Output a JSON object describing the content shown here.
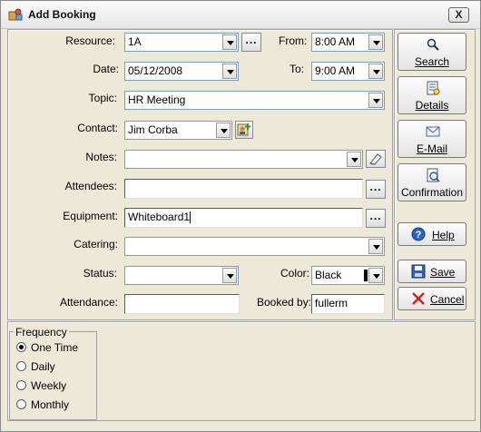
{
  "window": {
    "title": "Add Booking",
    "close_label": "X"
  },
  "form": {
    "resource_label": "Resource:",
    "resource_value": "1A",
    "from_label": "From:",
    "from_value": "8:00 AM",
    "date_label": "Date:",
    "date_value": "05/12/2008",
    "to_label": "To:",
    "to_value": "9:00 AM",
    "topic_label": "Topic:",
    "topic_value": "HR Meeting",
    "contact_label": "Contact:",
    "contact_value": "Jim Corba",
    "notes_label": "Notes:",
    "notes_value": "",
    "attendees_label": "Attendees:",
    "attendees_value": "",
    "equipment_label": "Equipment:",
    "equipment_value": "Whiteboard1",
    "catering_label": "Catering:",
    "catering_value": "",
    "status_label": "Status:",
    "status_value": "",
    "color_label": "Color:",
    "color_value": "Black",
    "color_swatch": "#000000",
    "attendance_label": "Attendance:",
    "attendance_value": "",
    "bookedby_label": "Booked by:",
    "bookedby_value": "fullerm",
    "ellipsis": "..."
  },
  "sidebar": {
    "search": "Search",
    "details": "Details",
    "email": "E-Mail",
    "confirmation": "Confirmation",
    "help": "Help",
    "save": "Save",
    "cancel": "Cancel"
  },
  "frequency": {
    "legend": "Frequency",
    "options": [
      "One Time",
      "Daily",
      "Weekly",
      "Monthly"
    ],
    "selected": "One Time"
  },
  "colors": {
    "selection": "#316ac5",
    "field_border": "#7f9db9",
    "window_bg": "#ece9d8"
  },
  "icons": [
    "app-icon",
    "search-icon",
    "details-icon",
    "email-icon",
    "confirmation-icon",
    "help-icon",
    "save-icon",
    "cancel-icon",
    "eraser-icon",
    "add-contact-icon"
  ]
}
